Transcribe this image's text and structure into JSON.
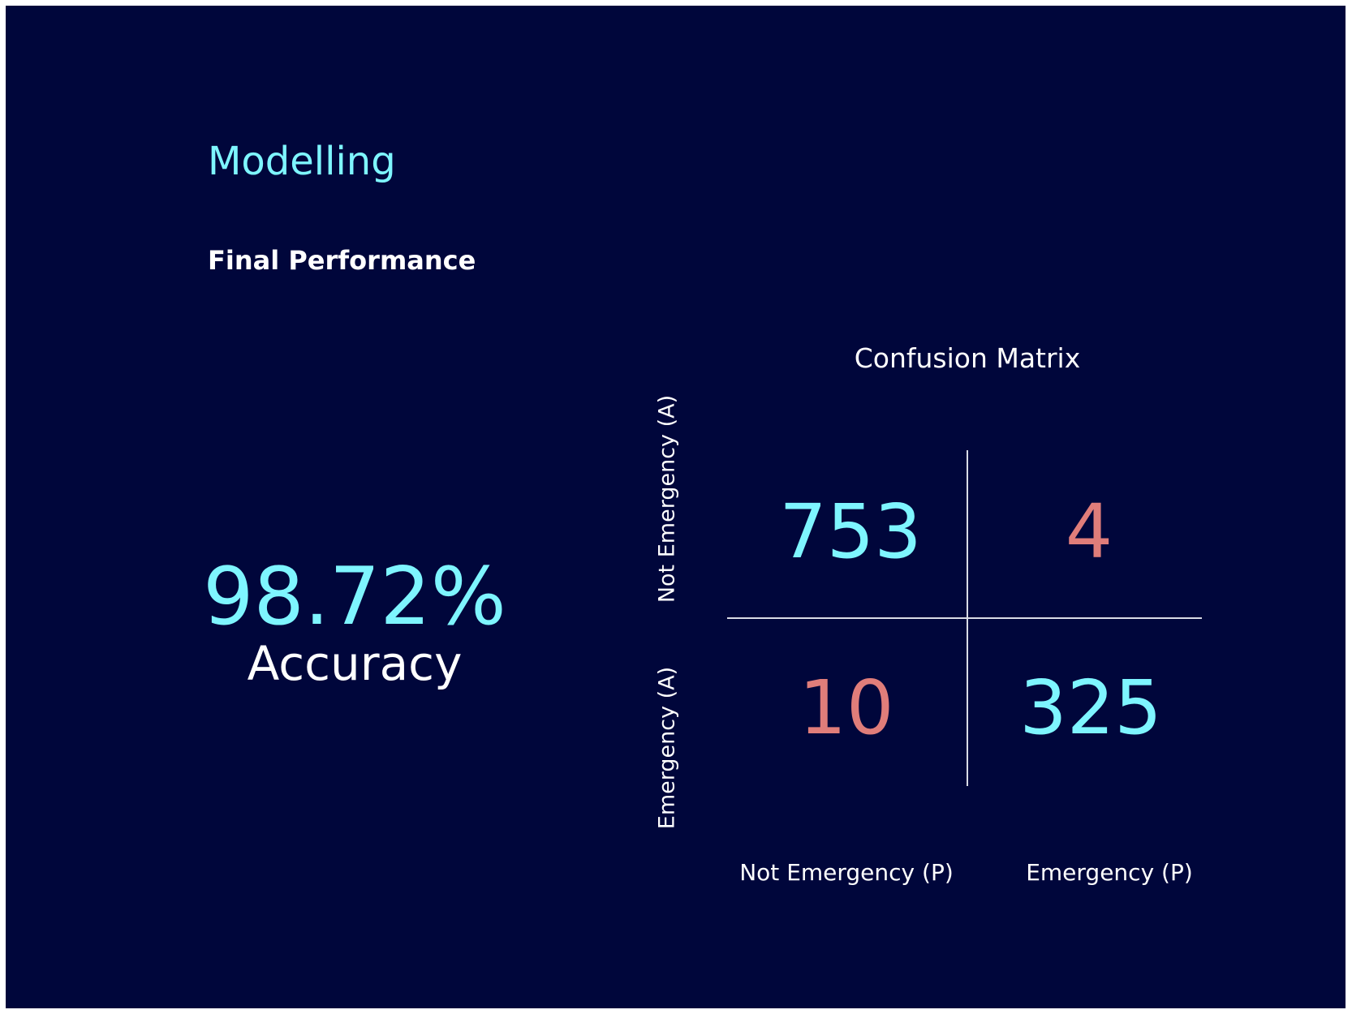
{
  "header": {
    "title": "Modelling",
    "subtitle": "Final Performance"
  },
  "metric": {
    "value": "98.72%",
    "label": "Accuracy"
  },
  "colors": {
    "background": "#00063b",
    "accent": "#7ef5ff",
    "error": "#e07d7a",
    "text": "#ffffff"
  },
  "chart_data": {
    "type": "table",
    "title": "Confusion Matrix",
    "rows": [
      "Not Emergency (A)",
      "Emergency (A)"
    ],
    "columns": [
      "Not Emergency (P)",
      "Emergency (P)"
    ],
    "values": [
      [
        753,
        4
      ],
      [
        10,
        325
      ]
    ]
  }
}
